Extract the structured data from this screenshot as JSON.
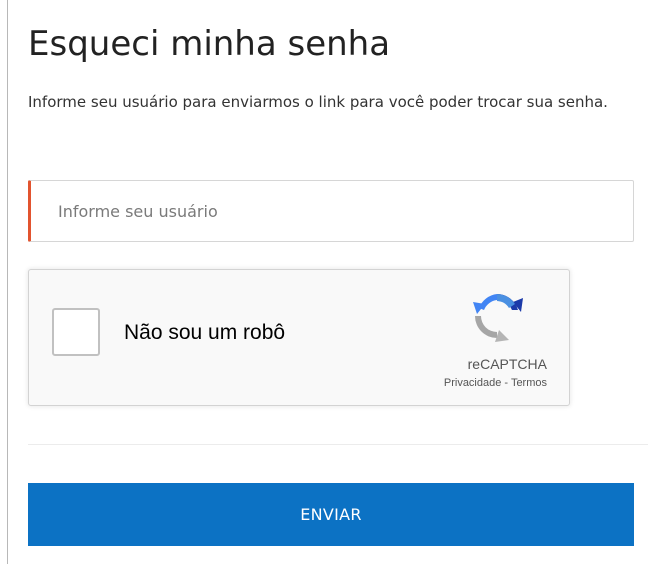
{
  "page": {
    "title": "Esqueci minha senha",
    "instructions": "Informe seu usuário para enviarmos o link para você poder trocar sua senha."
  },
  "form": {
    "username_placeholder": "Informe seu usuário",
    "username_value": "",
    "accent_color": "#e2542f"
  },
  "recaptcha": {
    "checkbox_label": "Não sou um robô",
    "checked": false,
    "brand": "reCAPTCHA",
    "privacy_label": "Privacidade",
    "separator": " - ",
    "terms_label": "Termos",
    "logo_icon": "recaptcha-logo-icon"
  },
  "actions": {
    "submit_label": "ENVIAR",
    "submit_color": "#0c72c4"
  }
}
